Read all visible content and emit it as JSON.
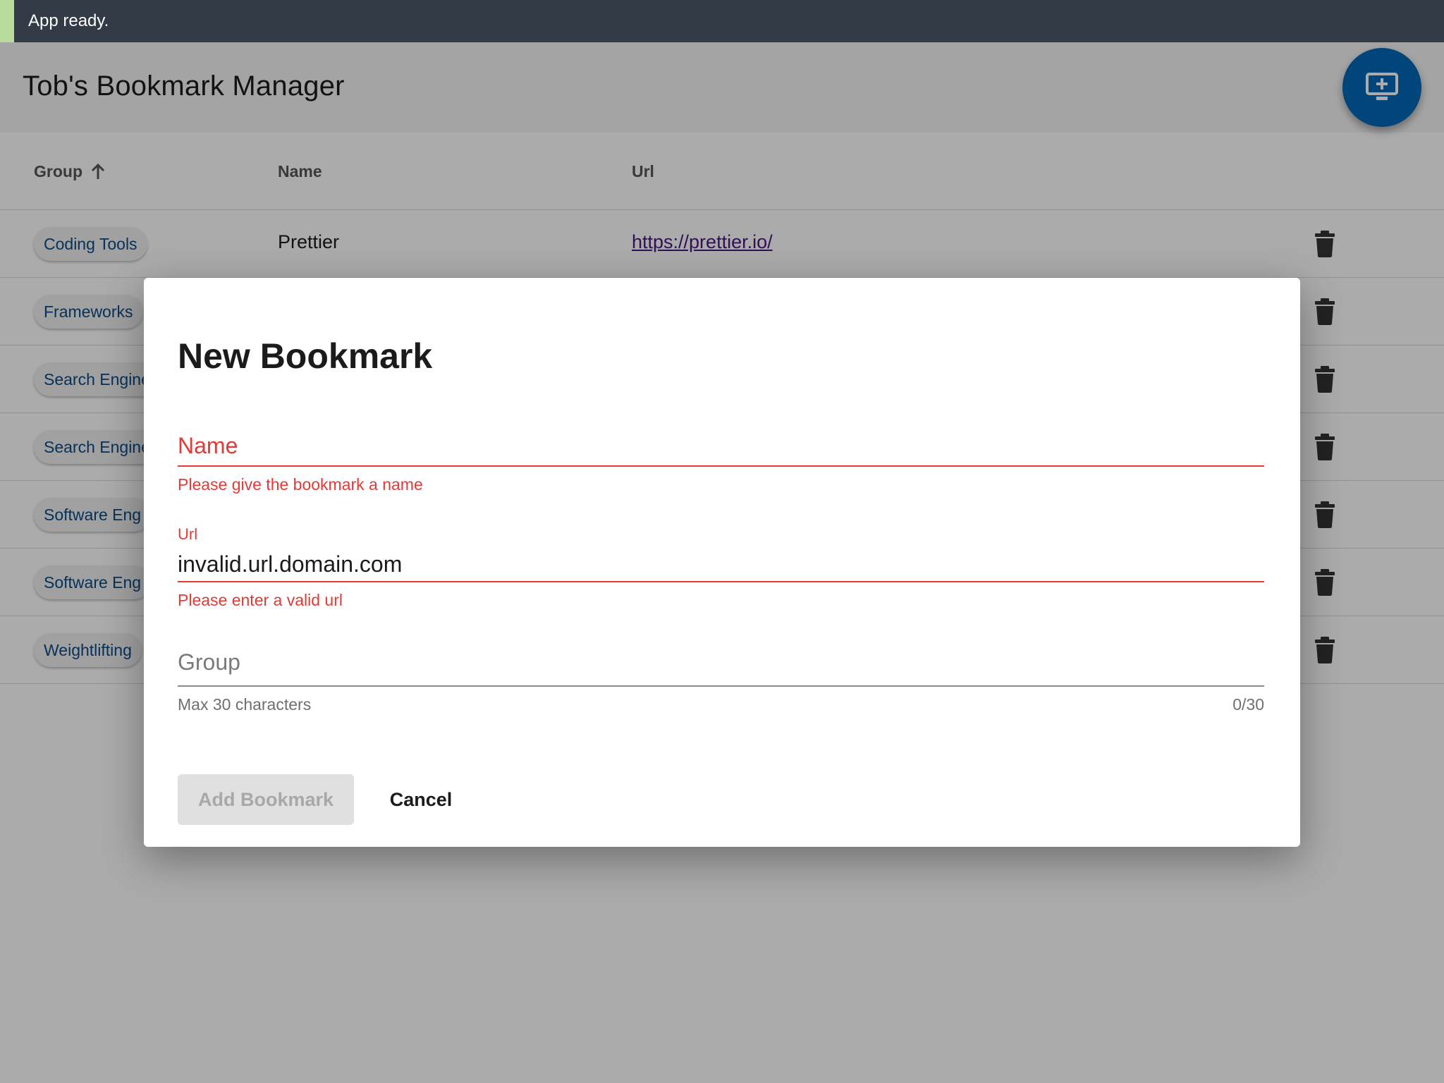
{
  "status_bar": {
    "text": "App ready."
  },
  "header": {
    "title": "Tob's Bookmark Manager",
    "add_icon": "add-to-screen-icon"
  },
  "table": {
    "columns": {
      "group": "Group",
      "name": "Name",
      "url": "Url"
    },
    "sort": {
      "column": "group",
      "direction": "ascending",
      "icon": "arrow-up-icon"
    },
    "rows": [
      {
        "group": "Coding Tools",
        "name": "Prettier",
        "url": "https://prettier.io/"
      },
      {
        "group": "Frameworks",
        "name": "",
        "url": ""
      },
      {
        "group": "Search Engine",
        "name": "",
        "url": ""
      },
      {
        "group": "Search Engine",
        "name": "",
        "url": ""
      },
      {
        "group": "Software Eng",
        "name": "",
        "url": ""
      },
      {
        "group": "Software Eng",
        "name": "",
        "url": ""
      },
      {
        "group": "Weightlifting",
        "name": "",
        "url": ""
      }
    ]
  },
  "dialog": {
    "title": "New Bookmark",
    "name_field": {
      "placeholder": "Name",
      "value": "",
      "error": "Please give the bookmark a name"
    },
    "url_field": {
      "label": "Url",
      "value": "invalid.url.domain.com",
      "error": "Please enter a valid url"
    },
    "group_field": {
      "placeholder": "Group",
      "value": "",
      "hint": "Max 30 characters",
      "counter": "0/30"
    },
    "add_button": "Add Bookmark",
    "cancel_button": "Cancel"
  },
  "colors": {
    "status_bar": "#323b46",
    "status_accent": "#b9dc9d",
    "fab": "#0069b8",
    "error": "#e53935",
    "chip_text": "#0d4a86",
    "link": "#4a1880"
  }
}
